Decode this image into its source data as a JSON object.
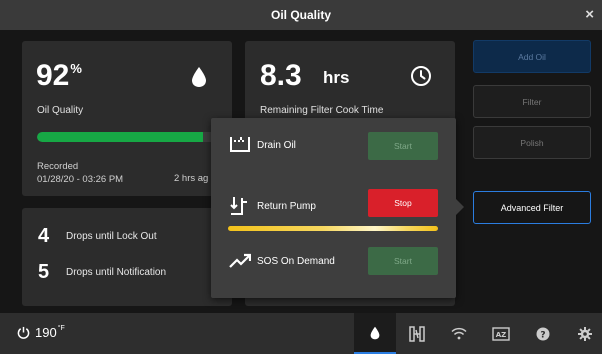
{
  "window": {
    "title": "Oil Quality",
    "close_label": "×"
  },
  "oil_quality": {
    "value": "92",
    "unit": "%",
    "label": "Oil Quality",
    "level": 0.92,
    "recorded_label": "Recorded",
    "recorded_time": "01/28/20 - 03:26 PM",
    "ago": "2 hrs ag"
  },
  "filter_time": {
    "value": "8.3",
    "unit": "hrs",
    "label": "Remaining Filter Cook Time"
  },
  "drops": [
    {
      "count": "4",
      "label": "Drops until Lock Out"
    },
    {
      "count": "5",
      "label": "Drops until Notification"
    }
  ],
  "side_buttons": {
    "add_oil": "Add Oil",
    "filter": "Filter",
    "polish": "Polish",
    "advanced": "Advanced Filter"
  },
  "popup": {
    "drain": {
      "label": "Drain Oil",
      "button": "Start"
    },
    "pump": {
      "label": "Return Pump",
      "button": "Stop"
    },
    "sos": {
      "label": "SOS On Demand",
      "button": "Start"
    }
  },
  "status": {
    "temperature": "190",
    "temp_unit": "°F"
  },
  "colors": {
    "accent_blue": "#2a7de1",
    "good_green": "#17a845",
    "stop_red": "#d9202a",
    "pump_yellow": "#f3c21a"
  },
  "icons": [
    "close-icon",
    "oil-drop-icon",
    "clock-icon",
    "drain-icon",
    "pump-icon",
    "trend-icon",
    "power-icon",
    "filter-tab-icon",
    "wifi-icon",
    "ab-icon",
    "help-icon",
    "settings-icon"
  ]
}
